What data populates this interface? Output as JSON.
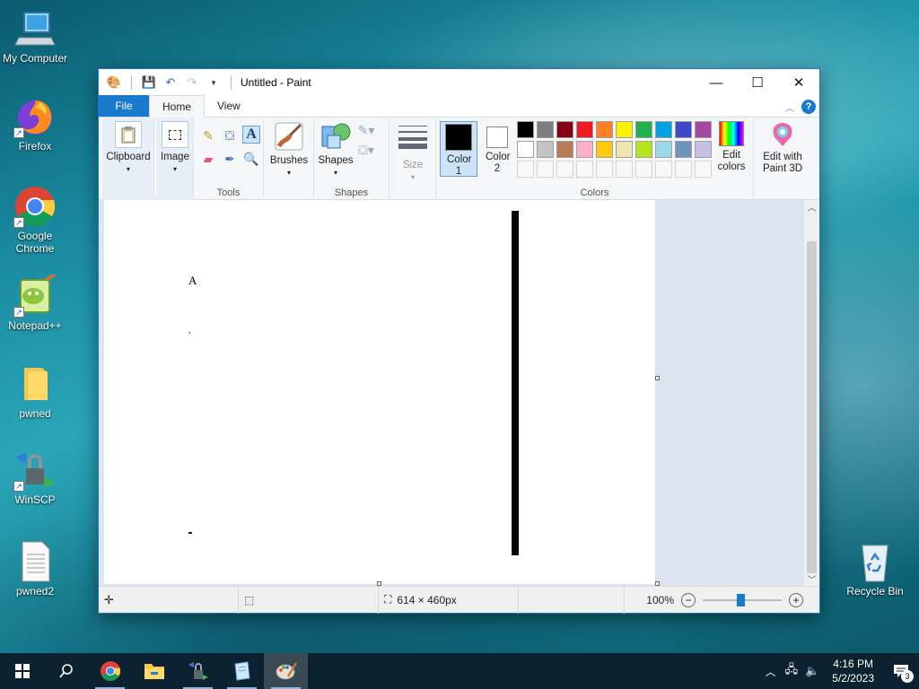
{
  "desktop": {
    "icons": [
      {
        "label": "My Computer",
        "icon": "computer-icon"
      },
      {
        "label": "Firefox",
        "icon": "firefox-icon"
      },
      {
        "label": "Google Chrome",
        "icon": "chrome-icon"
      },
      {
        "label": "Notepad++",
        "icon": "notepadpp-icon"
      },
      {
        "label": "pwned",
        "icon": "folder-icon"
      },
      {
        "label": "WinSCP",
        "icon": "winscp-icon"
      },
      {
        "label": "pwned2",
        "icon": "text-file-icon"
      },
      {
        "label": "Recycle Bin",
        "icon": "recycle-bin-icon"
      }
    ]
  },
  "window": {
    "title": "Untitled - Paint",
    "tabs": {
      "file": "File",
      "home": "Home",
      "view": "View"
    },
    "ribbon": {
      "clipboard": "Clipboard",
      "image": "Image",
      "tools": "Tools",
      "brushes": "Brushes",
      "shapes": "Shapes",
      "shapes_group": "Shapes",
      "size": "Size",
      "color1": "Color 1",
      "color2": "Color 2",
      "colors_group": "Colors",
      "edit_colors": "Edit colors",
      "paint3d": "Edit with Paint 3D"
    },
    "palette_row1": [
      "#000000",
      "#7f7f7f",
      "#880015",
      "#ed1c24",
      "#ff7f27",
      "#fff200",
      "#22b14c",
      "#00a2e8",
      "#3f48cc",
      "#a349a4"
    ],
    "palette_row2": [
      "#ffffff",
      "#c3c3c3",
      "#b97a57",
      "#ffaec9",
      "#ffc90e",
      "#efe4b0",
      "#b5e61d",
      "#99d9ea",
      "#7092be",
      "#c8bfe7"
    ],
    "color1": "#000000",
    "color2": "#ffffff",
    "canvas_text": "A",
    "status": {
      "dimensions": "614 × 460px",
      "zoom": "100%"
    }
  },
  "taskbar": {
    "apps": [
      "start-icon",
      "search-icon",
      "chrome-icon",
      "file-explorer-icon",
      "winscp-icon",
      "notepad-icon",
      "paint-icon"
    ],
    "time": "4:16 PM",
    "date": "5/2/2023",
    "notifications": "3"
  }
}
